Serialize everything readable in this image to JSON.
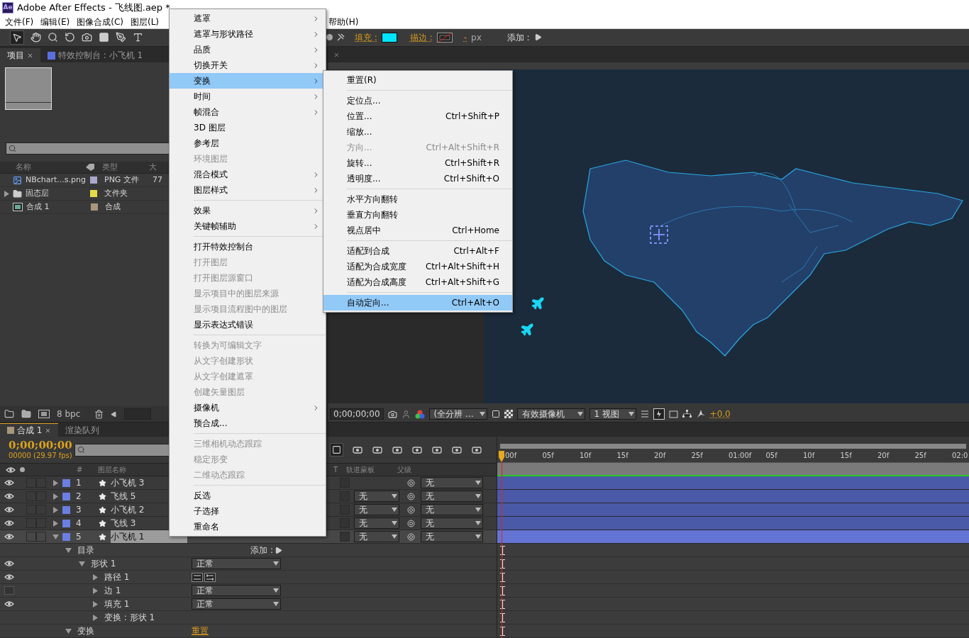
{
  "window": {
    "logo": "Ae",
    "title": "Adobe After Effects - 飞线图.aep *"
  },
  "menubar": [
    {
      "label": "文件(F)"
    },
    {
      "label": "编辑(E)"
    },
    {
      "label": "图像合成(C)"
    },
    {
      "label": "图层(L)"
    },
    {
      "label": "帮助(H)"
    }
  ],
  "toolbar": {
    "fill_label": "填充 :",
    "stroke_label": "描边 :",
    "stroke_width": "-",
    "unit": "px",
    "add_label": "添加 :"
  },
  "project": {
    "tabs": [
      {
        "label": "项目",
        "selected": true
      },
      {
        "label": "特效控制台 : 小飞机 1",
        "selected": false
      }
    ],
    "columns": [
      "名称",
      "类型",
      "大"
    ],
    "items": [
      {
        "kind": "image",
        "name": "NBchart...s.png",
        "color": "#a8a8cc",
        "type": "PNG 文件",
        "size": "77"
      },
      {
        "kind": "folder",
        "name": "固态层",
        "color": "#e4da4a",
        "type": "文件夹",
        "expanded": false
      },
      {
        "kind": "comp",
        "name": "合成 1",
        "color": "#a8977a",
        "type": "合成"
      }
    ],
    "bit_depth": "8 bpc"
  },
  "viewer": {
    "timecode": "0;00;00;00",
    "resolution": "(全分辨 ...",
    "camera": "有效摄像机",
    "views": "1 视图",
    "exposure": "+0.0"
  },
  "timeline": {
    "tabs": [
      {
        "label": "合成 1",
        "selected": true
      },
      {
        "label": "渲染队列",
        "selected": false
      }
    ],
    "timecode": "0;00;00;00",
    "fps": "00000 (29.97 fps)",
    "columns": {
      "index": "#",
      "name": "图层名称",
      "t": "T",
      "matte": "轨道蒙板",
      "parent": "父级"
    },
    "ticks": [
      "00f",
      "05f",
      "10f",
      "15f",
      "20f",
      "25f",
      "01:00f",
      "05f",
      "10f",
      "15f",
      "20f",
      "25f",
      "02:0"
    ],
    "layers": [
      {
        "index": "1",
        "name": "小飞机 3",
        "color": "#6a7fe0",
        "visible": true,
        "selected": false,
        "expanded": false,
        "parent": "无"
      },
      {
        "index": "2",
        "name": "飞线 5",
        "color": "#6a7fe0",
        "visible": true,
        "selected": false,
        "expanded": false,
        "track_matte": "无",
        "parent": "无"
      },
      {
        "index": "3",
        "name": "小飞机 2",
        "color": "#6a7fe0",
        "visible": true,
        "selected": false,
        "expanded": false,
        "track_matte": "无",
        "parent": "无"
      },
      {
        "index": "4",
        "name": "飞线 3",
        "color": "#6a7fe0",
        "visible": true,
        "selected": false,
        "expanded": false,
        "track_matte": "无",
        "parent": "无"
      },
      {
        "index": "5",
        "name": "小飞机 1",
        "color": "#6a7fe0",
        "visible": true,
        "selected": true,
        "expanded": true,
        "track_matte": "无",
        "parent": "无"
      }
    ],
    "properties": [
      {
        "name": "目录",
        "expanded": true,
        "add_label": "添加 :",
        "children": [
          {
            "name": "形状 1",
            "expanded": true,
            "visible": true,
            "mode": "正常",
            "children": [
              {
                "name": "路径 1",
                "kind": "path",
                "expanded": false,
                "visible": true
              },
              {
                "name": "边 1",
                "expanded": false,
                "visible": false,
                "mode": "正常"
              },
              {
                "name": "填充 1",
                "expanded": false,
                "visible": true,
                "mode": "正常"
              },
              {
                "name": "变换 : 形状 1",
                "expanded": false
              }
            ]
          }
        ]
      },
      {
        "name": "变换",
        "expanded": true,
        "link": "重置"
      }
    ]
  },
  "context_menu": {
    "items": [
      {
        "label": "遮罩",
        "submenu": true,
        "disabled": false,
        "selected": false
      },
      {
        "label": "遮罩与形状路径",
        "submenu": true,
        "disabled": false,
        "selected": false
      },
      {
        "label": "品质",
        "submenu": true,
        "disabled": false,
        "selected": false
      },
      {
        "label": "切换开关",
        "submenu": true,
        "disabled": false,
        "selected": false
      },
      {
        "label": "变换",
        "submenu": true,
        "disabled": false,
        "selected": true
      },
      {
        "label": "时间",
        "submenu": true,
        "disabled": false,
        "selected": false
      },
      {
        "label": "帧混合",
        "submenu": true,
        "disabled": false,
        "selected": false
      },
      {
        "label": "3D 图层",
        "submenu": false,
        "disabled": false,
        "selected": false
      },
      {
        "label": "参考层",
        "submenu": false,
        "disabled": false,
        "selected": false
      },
      {
        "label": "环境图层",
        "submenu": false,
        "disabled": true,
        "selected": false
      },
      {
        "label": "混合模式",
        "submenu": true,
        "disabled": false,
        "selected": false
      },
      {
        "label": "图层样式",
        "submenu": true,
        "disabled": false,
        "selected": false
      },
      {
        "kind": "separator"
      },
      {
        "label": "效果",
        "submenu": true,
        "disabled": false,
        "selected": false
      },
      {
        "label": "关键帧辅助",
        "submenu": true,
        "disabled": false,
        "selected": false
      },
      {
        "kind": "separator"
      },
      {
        "label": "打开特效控制台",
        "submenu": false,
        "disabled": false,
        "selected": false
      },
      {
        "label": "打开图层",
        "submenu": false,
        "disabled": true,
        "selected": false
      },
      {
        "label": "打开图层源窗口",
        "submenu": false,
        "disabled": true,
        "selected": false
      },
      {
        "label": "显示项目中的图层来源",
        "submenu": false,
        "disabled": true,
        "selected": false
      },
      {
        "label": "显示项目流程图中的图层",
        "submenu": false,
        "disabled": true,
        "selected": false
      },
      {
        "label": "显示表达式错误",
        "submenu": false,
        "disabled": false,
        "selected": false
      },
      {
        "kind": "separator"
      },
      {
        "label": "转换为可编辑文字",
        "submenu": false,
        "disabled": true,
        "selected": false
      },
      {
        "label": "从文字创建形状",
        "submenu": false,
        "disabled": true,
        "selected": false
      },
      {
        "label": "从文字创建遮罩",
        "submenu": false,
        "disabled": true,
        "selected": false
      },
      {
        "label": "创建矢量图层",
        "submenu": false,
        "disabled": true,
        "selected": false
      },
      {
        "label": "摄像机",
        "submenu": true,
        "disabled": false,
        "selected": false
      },
      {
        "label": "预合成...",
        "submenu": false,
        "disabled": false,
        "selected": false
      },
      {
        "kind": "separator"
      },
      {
        "label": "三维相机动态跟踪",
        "submenu": false,
        "disabled": true,
        "selected": false
      },
      {
        "label": "稳定形变",
        "submenu": false,
        "disabled": true,
        "selected": false
      },
      {
        "label": "二维动态跟踪",
        "submenu": false,
        "disabled": true,
        "selected": false
      },
      {
        "kind": "separator"
      },
      {
        "label": "反选",
        "submenu": false,
        "disabled": false,
        "selected": false
      },
      {
        "label": "子选择",
        "submenu": false,
        "disabled": false,
        "selected": false
      },
      {
        "label": "重命名",
        "submenu": false,
        "disabled": false,
        "selected": false
      }
    ]
  },
  "submenu": {
    "items": [
      {
        "label": "重置(R)",
        "disabled": false,
        "selected": false
      },
      {
        "kind": "separator"
      },
      {
        "label": "定位点...",
        "disabled": false,
        "selected": false
      },
      {
        "label": "位置...",
        "shortcut": "Ctrl+Shift+P",
        "disabled": false,
        "selected": false
      },
      {
        "label": "缩放...",
        "disabled": false,
        "selected": false
      },
      {
        "label": "方向...",
        "shortcut": "Ctrl+Alt+Shift+R",
        "disabled": true,
        "selected": false
      },
      {
        "label": "旋转...",
        "shortcut": "Ctrl+Shift+R",
        "disabled": false,
        "selected": false
      },
      {
        "label": "透明度...",
        "shortcut": "Ctrl+Shift+O",
        "disabled": false,
        "selected": false
      },
      {
        "kind": "separator"
      },
      {
        "label": "水平方向翻转",
        "disabled": false,
        "selected": false
      },
      {
        "label": "垂直方向翻转",
        "disabled": false,
        "selected": false
      },
      {
        "label": "视点居中",
        "shortcut": "Ctrl+Home",
        "disabled": false,
        "selected": false
      },
      {
        "kind": "separator"
      },
      {
        "label": "适配到合成",
        "shortcut": "Ctrl+Alt+F",
        "disabled": false,
        "selected": false
      },
      {
        "label": "适配为合成宽度",
        "shortcut": "Ctrl+Alt+Shift+H",
        "disabled": false,
        "selected": false
      },
      {
        "label": "适配为合成高度",
        "shortcut": "Ctrl+Alt+Shift+G",
        "disabled": false,
        "selected": false
      },
      {
        "kind": "separator"
      },
      {
        "label": "自动定向...",
        "shortcut": "Ctrl+Alt+O",
        "disabled": false,
        "selected": true
      }
    ]
  }
}
